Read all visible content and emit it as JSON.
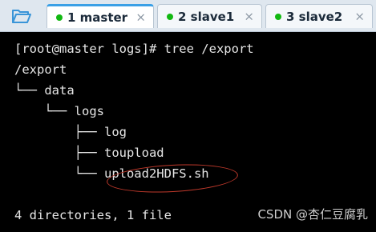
{
  "tabs": [
    {
      "label": "1 master",
      "active": true,
      "status_color": "#11b811"
    },
    {
      "label": "2 slave1",
      "active": false,
      "status_color": "#11b811"
    },
    {
      "label": "3 slave2",
      "active": false,
      "status_color": "#11b811"
    }
  ],
  "close_glyph": "×",
  "icons": {
    "open_session": "folder-open-icon",
    "close": "close-icon",
    "status": "status-dot-icon"
  },
  "terminal": {
    "lines": [
      "[root@master logs]# tree /export",
      "/export",
      "└── data",
      "    └── logs",
      "        ├── log",
      "        ├── toupload",
      "        └── upload2HDFS.sh",
      "",
      "4 directories, 1 file"
    ],
    "highlighted_item": "upload2HDFS.sh"
  },
  "watermark": "CSDN @杏仁豆腐乳",
  "colors": {
    "accent": "#3aa0e6",
    "highlight_ellipse": "#c0392b",
    "terminal_bg": "#000000",
    "terminal_text": "#e6e6e6"
  }
}
